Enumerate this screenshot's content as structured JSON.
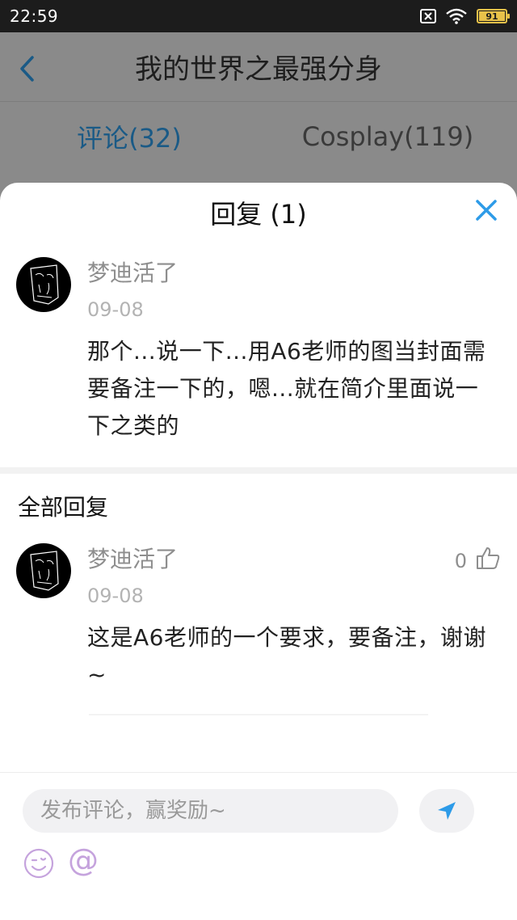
{
  "status_bar": {
    "time": "22:59",
    "battery": "91",
    "battery_level": 0.91
  },
  "background_page": {
    "title": "我的世界之最强分身",
    "tabs": [
      {
        "label": "评论(32)"
      },
      {
        "label": "Cosplay(119)"
      }
    ]
  },
  "sheet": {
    "title": "回复 (1)",
    "main_comment": {
      "name": "梦迪活了",
      "date": "09-08",
      "text": "那个...说一下...用A6老师的图当封面需要备注一下的，嗯...就在简介里面说一下之类的"
    },
    "all_replies_label": "全部回复",
    "replies": [
      {
        "name": "梦迪活了",
        "date": "09-08",
        "text": "这是A6老师的一个要求，要备注，谢谢 ~",
        "likes": "0"
      }
    ]
  },
  "composer": {
    "placeholder": "发布评论，赢奖励~",
    "at_label": "@"
  },
  "colors": {
    "accent": "#2d9be8",
    "emoji": "#c5a3dd"
  },
  "icons": [
    "back-icon",
    "mute-icon",
    "wifi-icon",
    "close-icon",
    "like-icon",
    "send-icon",
    "emoji-icon"
  ]
}
